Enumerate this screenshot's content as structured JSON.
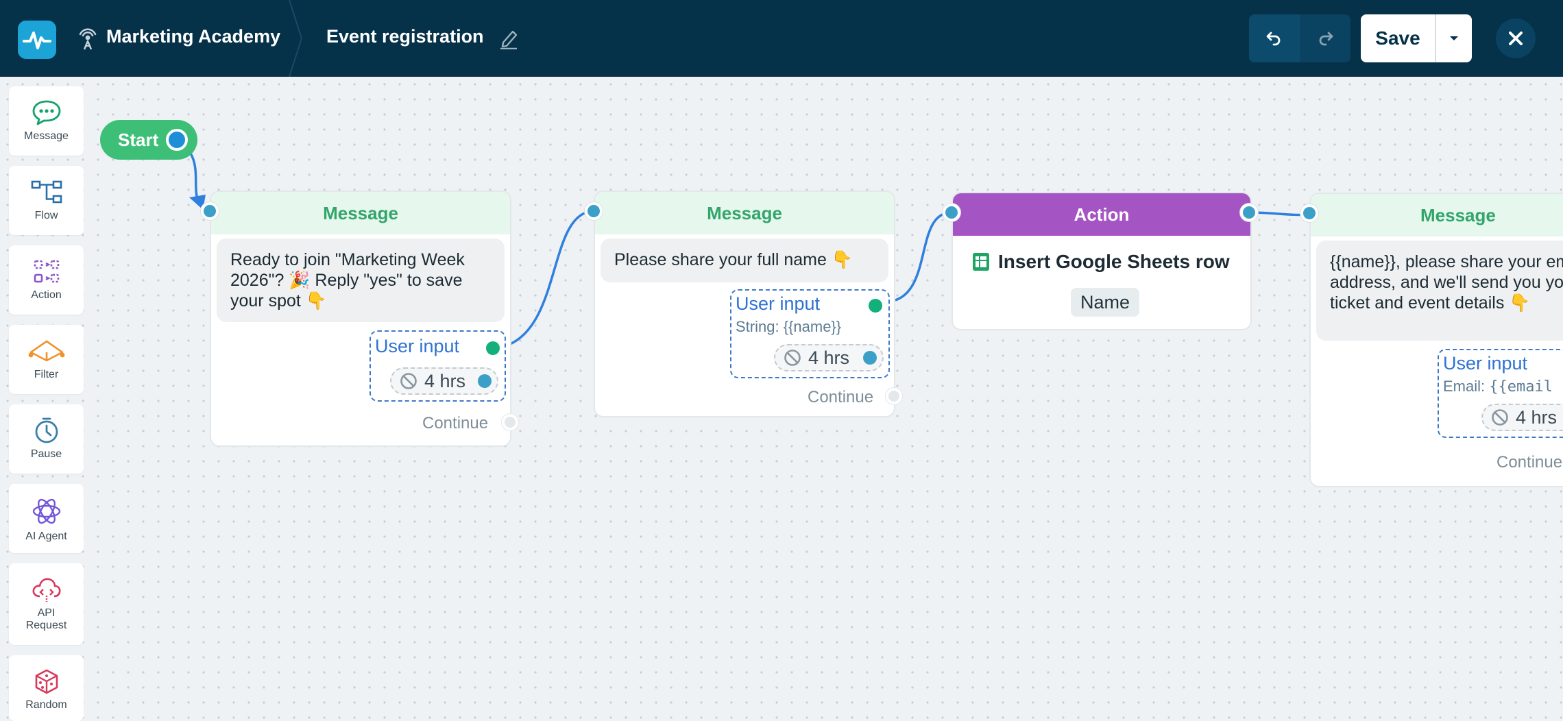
{
  "header": {
    "workspace_name": "Marketing Academy",
    "flow_name": "Event registration",
    "save_label": "Save",
    "icons": {
      "logo": "pulse-logo-icon",
      "workspace": "broadcast-icon",
      "edit": "pencil-icon",
      "undo": "undo-icon",
      "redo": "redo-icon",
      "dropdown": "chevron-down-icon",
      "close": "close-icon"
    }
  },
  "sidebar": {
    "items": [
      {
        "label": "Message",
        "icon": "chat-bubble-icon",
        "color": "#14a06b"
      },
      {
        "label": "Flow",
        "icon": "flow-icon",
        "color": "#2b6fa8"
      },
      {
        "label": "Action",
        "icon": "action-icon",
        "color": "#8a55c8"
      },
      {
        "label": "Filter",
        "icon": "filter-icon",
        "color": "#f0922c"
      },
      {
        "label": "Pause",
        "icon": "clock-icon",
        "color": "#3b7fa8"
      },
      {
        "label": "AI Agent",
        "icon": "ai-agent-icon",
        "color": "#7356d8"
      },
      {
        "label": "API Request",
        "icon": "cloud-api-icon",
        "color": "#d8385a"
      },
      {
        "label": "Random",
        "icon": "dice-icon",
        "color": "#d8385a"
      }
    ]
  },
  "canvas": {
    "start_label": "Start",
    "nodes": [
      {
        "type": "Message",
        "text": "Ready to join \"Marketing Week 2026\"? 🎉 Reply \"yes\" to save your spot 👇",
        "input_title": "User input",
        "input_subtitle": "",
        "timeout": "4 hrs",
        "continue": "Continue"
      },
      {
        "type": "Message",
        "text": "Please share your full name 👇",
        "input_title": "User input",
        "input_subtitle": "String: {{name}}",
        "timeout": "4 hrs",
        "continue": "Continue"
      },
      {
        "type": "Action",
        "action_title": "Insert Google Sheets row",
        "field_chip": "Name",
        "icon": "google-sheets-icon"
      },
      {
        "type": "Message",
        "text": "{{name}}, please share your email address, and we'll send you your ticket and event details 👇",
        "input_title": "User input",
        "input_subtitle_prefix": "Email: ",
        "input_subtitle_var": "{{email",
        "timeout": "4 hrs",
        "continue": "Continue"
      }
    ]
  },
  "colors": {
    "topbar": "#053149",
    "accent": "#1da4d6",
    "message_header_bg": "#e6f8ee",
    "message_header_text": "#33a56b",
    "action_header_bg": "#a554c3",
    "start_bg": "#3ebf78",
    "wire": "#2f7fde"
  }
}
